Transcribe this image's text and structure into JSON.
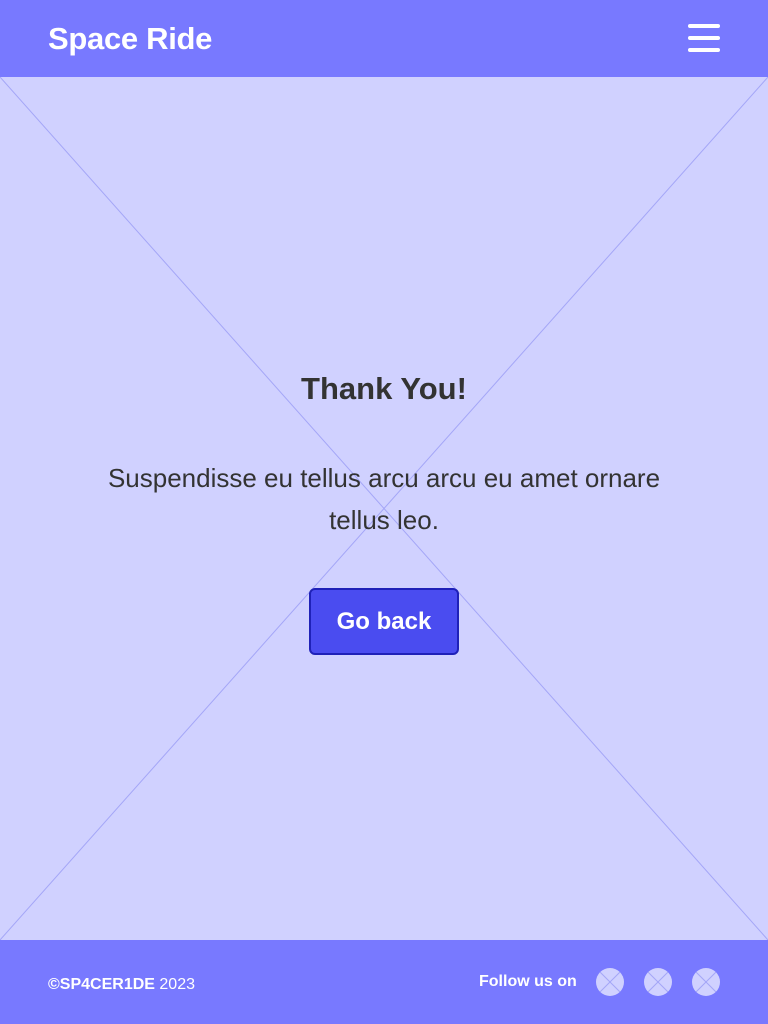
{
  "header": {
    "brand": "Space Ride",
    "menu_icon": "hamburger-menu-icon"
  },
  "main": {
    "title": "Thank You!",
    "message": "Suspendisse eu tellus arcu arcu eu amet ornare tellus leo.",
    "button_label": "Go back",
    "background_icon": "image-placeholder-icon"
  },
  "footer": {
    "copyright_brand": "©SP4CER1DE",
    "copyright_year": "2023",
    "follow_label": "Follow us on",
    "social_icons": [
      "social-placeholder-icon",
      "social-placeholder-icon",
      "social-placeholder-icon"
    ]
  },
  "colors": {
    "header_bg": "#7879ff",
    "page_bg": "#d0d1ff",
    "button_bg": "#4a4cf0",
    "button_border": "#1f21b8",
    "text_dark": "#333333"
  }
}
